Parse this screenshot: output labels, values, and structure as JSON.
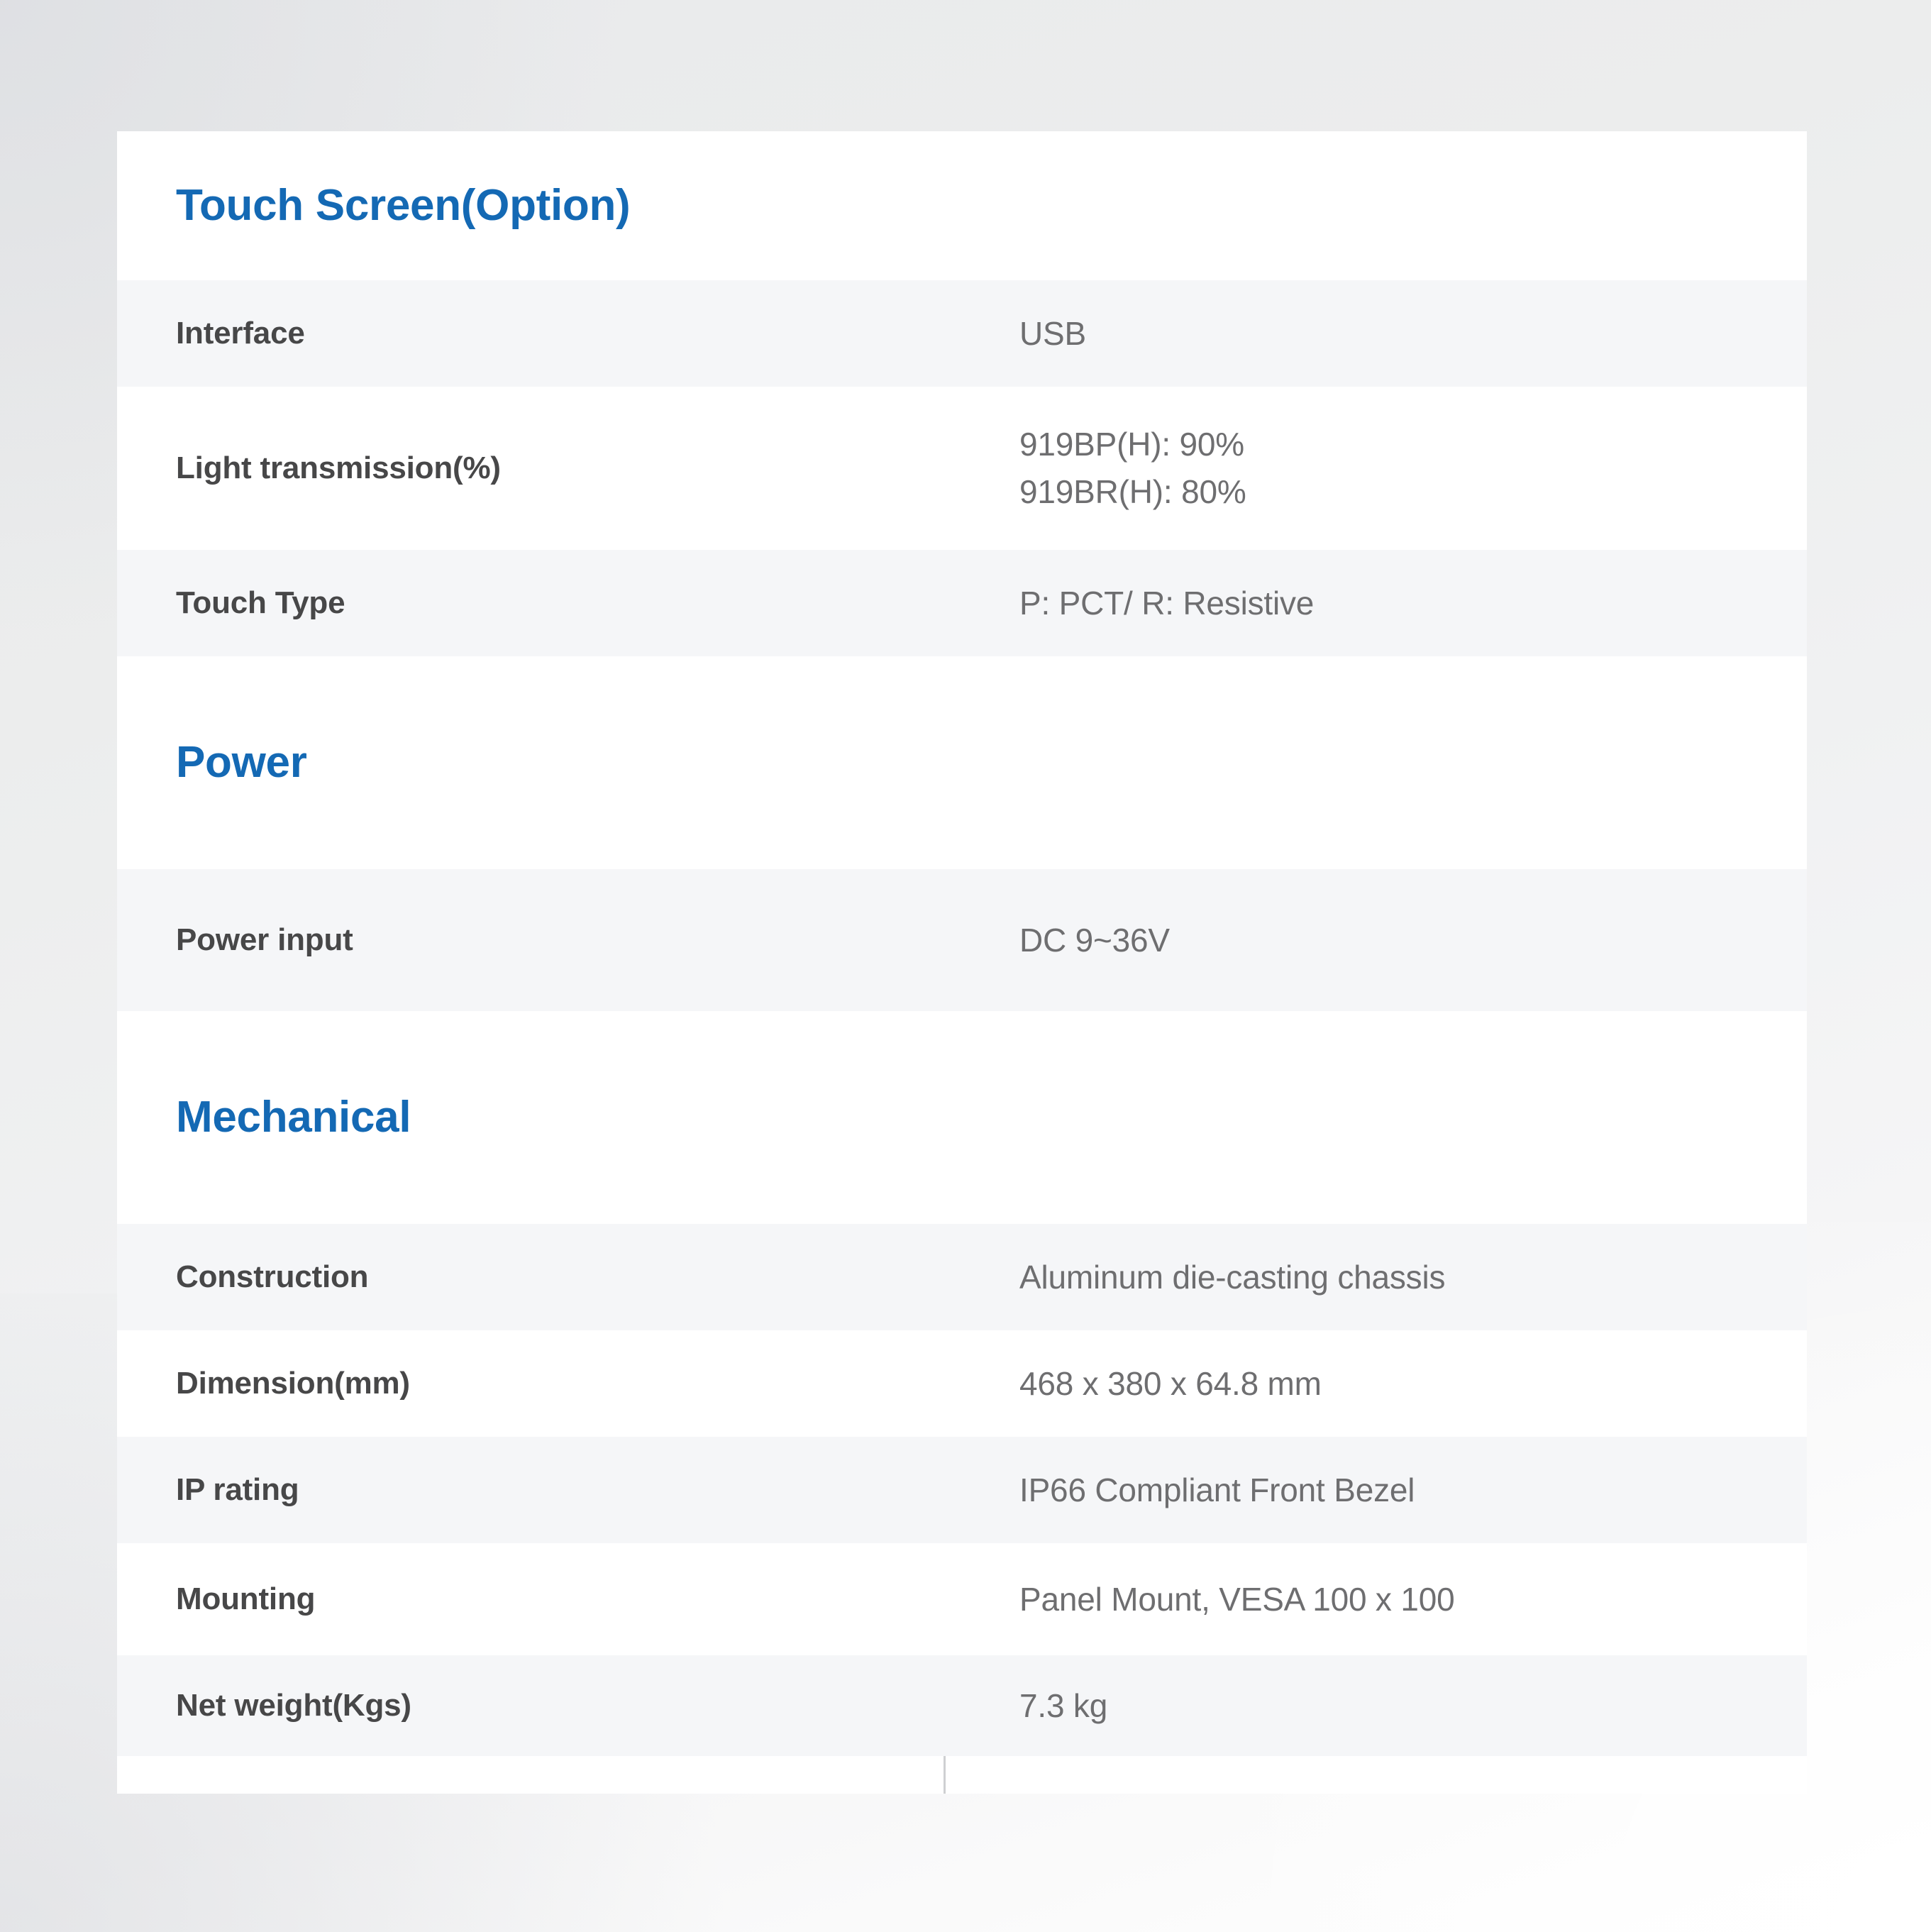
{
  "theme": {
    "accent_blue": "#1469b4",
    "label_gray": "#474748",
    "value_gray": "#6e6e70",
    "row_stripe": "#f5f6f8",
    "row_plain": "#ffffff",
    "divider": "#cfd0d2",
    "page_background": "#ecedef"
  },
  "spec_table": {
    "sections": [
      {
        "title": "Touch Screen(Option)",
        "rows": [
          {
            "label": "Interface",
            "value": "USB"
          },
          {
            "label": "Light transmission(%)",
            "value": "919BP(H): 90%\n919BR(H): 80%"
          },
          {
            "label": "Touch Type",
            "value": "P: PCT/ R: Resistive"
          }
        ]
      },
      {
        "title": "Power",
        "rows": [
          {
            "label": "Power input",
            "value": "DC 9~36V"
          }
        ]
      },
      {
        "title": "Mechanical",
        "rows": [
          {
            "label": "Construction",
            "value": "Aluminum die-casting chassis"
          },
          {
            "label": "Dimension(mm)",
            "value": "468 x 380 x 64.8 mm"
          },
          {
            "label": "IP rating",
            "value": "IP66 Compliant Front Bezel"
          },
          {
            "label": "Mounting",
            "value": "Panel Mount, VESA 100 x 100"
          },
          {
            "label": "Net weight(Kgs)",
            "value": "7.3 kg"
          }
        ]
      }
    ]
  }
}
